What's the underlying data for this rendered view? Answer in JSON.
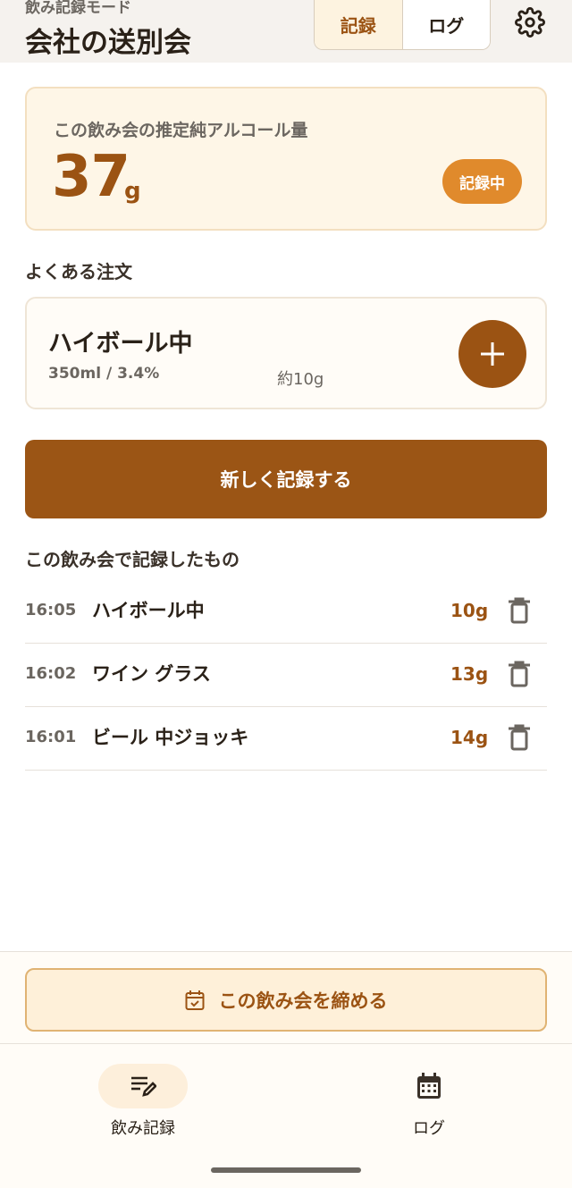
{
  "header": {
    "mode_label": "飲み記録モード",
    "title": "会社の送別会",
    "tabs": [
      {
        "label": "記録",
        "active": true
      },
      {
        "label": "ログ",
        "active": false
      }
    ],
    "settings_icon": "gear-icon"
  },
  "summary": {
    "label": "この飲み会の推定純アルコール量",
    "value": "37",
    "unit": "g",
    "status_badge": "記録中"
  },
  "frequent": {
    "section_title": "よくある注文",
    "item": {
      "name": "ハイボール中",
      "spec": "350ml / 3.4%",
      "approx": "約10g",
      "add_icon": "plus-icon"
    }
  },
  "new_record_label": "新しく記録する",
  "records": {
    "section_title": "この飲み会で記録したもの",
    "items": [
      {
        "time": "16:05",
        "name": "ハイボール中",
        "grams": "10g"
      },
      {
        "time": "16:02",
        "name": "ワイン グラス",
        "grams": "13g"
      },
      {
        "time": "16:01",
        "name": "ビール 中ジョッキ",
        "grams": "14g"
      }
    ]
  },
  "close_session_label": "この飲み会を締める",
  "bottom_nav": [
    {
      "label": "飲み記録",
      "icon": "edit-list-icon",
      "active": true
    },
    {
      "label": "ログ",
      "icon": "calendar-icon",
      "active": false
    }
  ],
  "colors": {
    "accent": "#9b5313",
    "badge": "#e08a2c",
    "card_bg": "#fef6e7"
  }
}
